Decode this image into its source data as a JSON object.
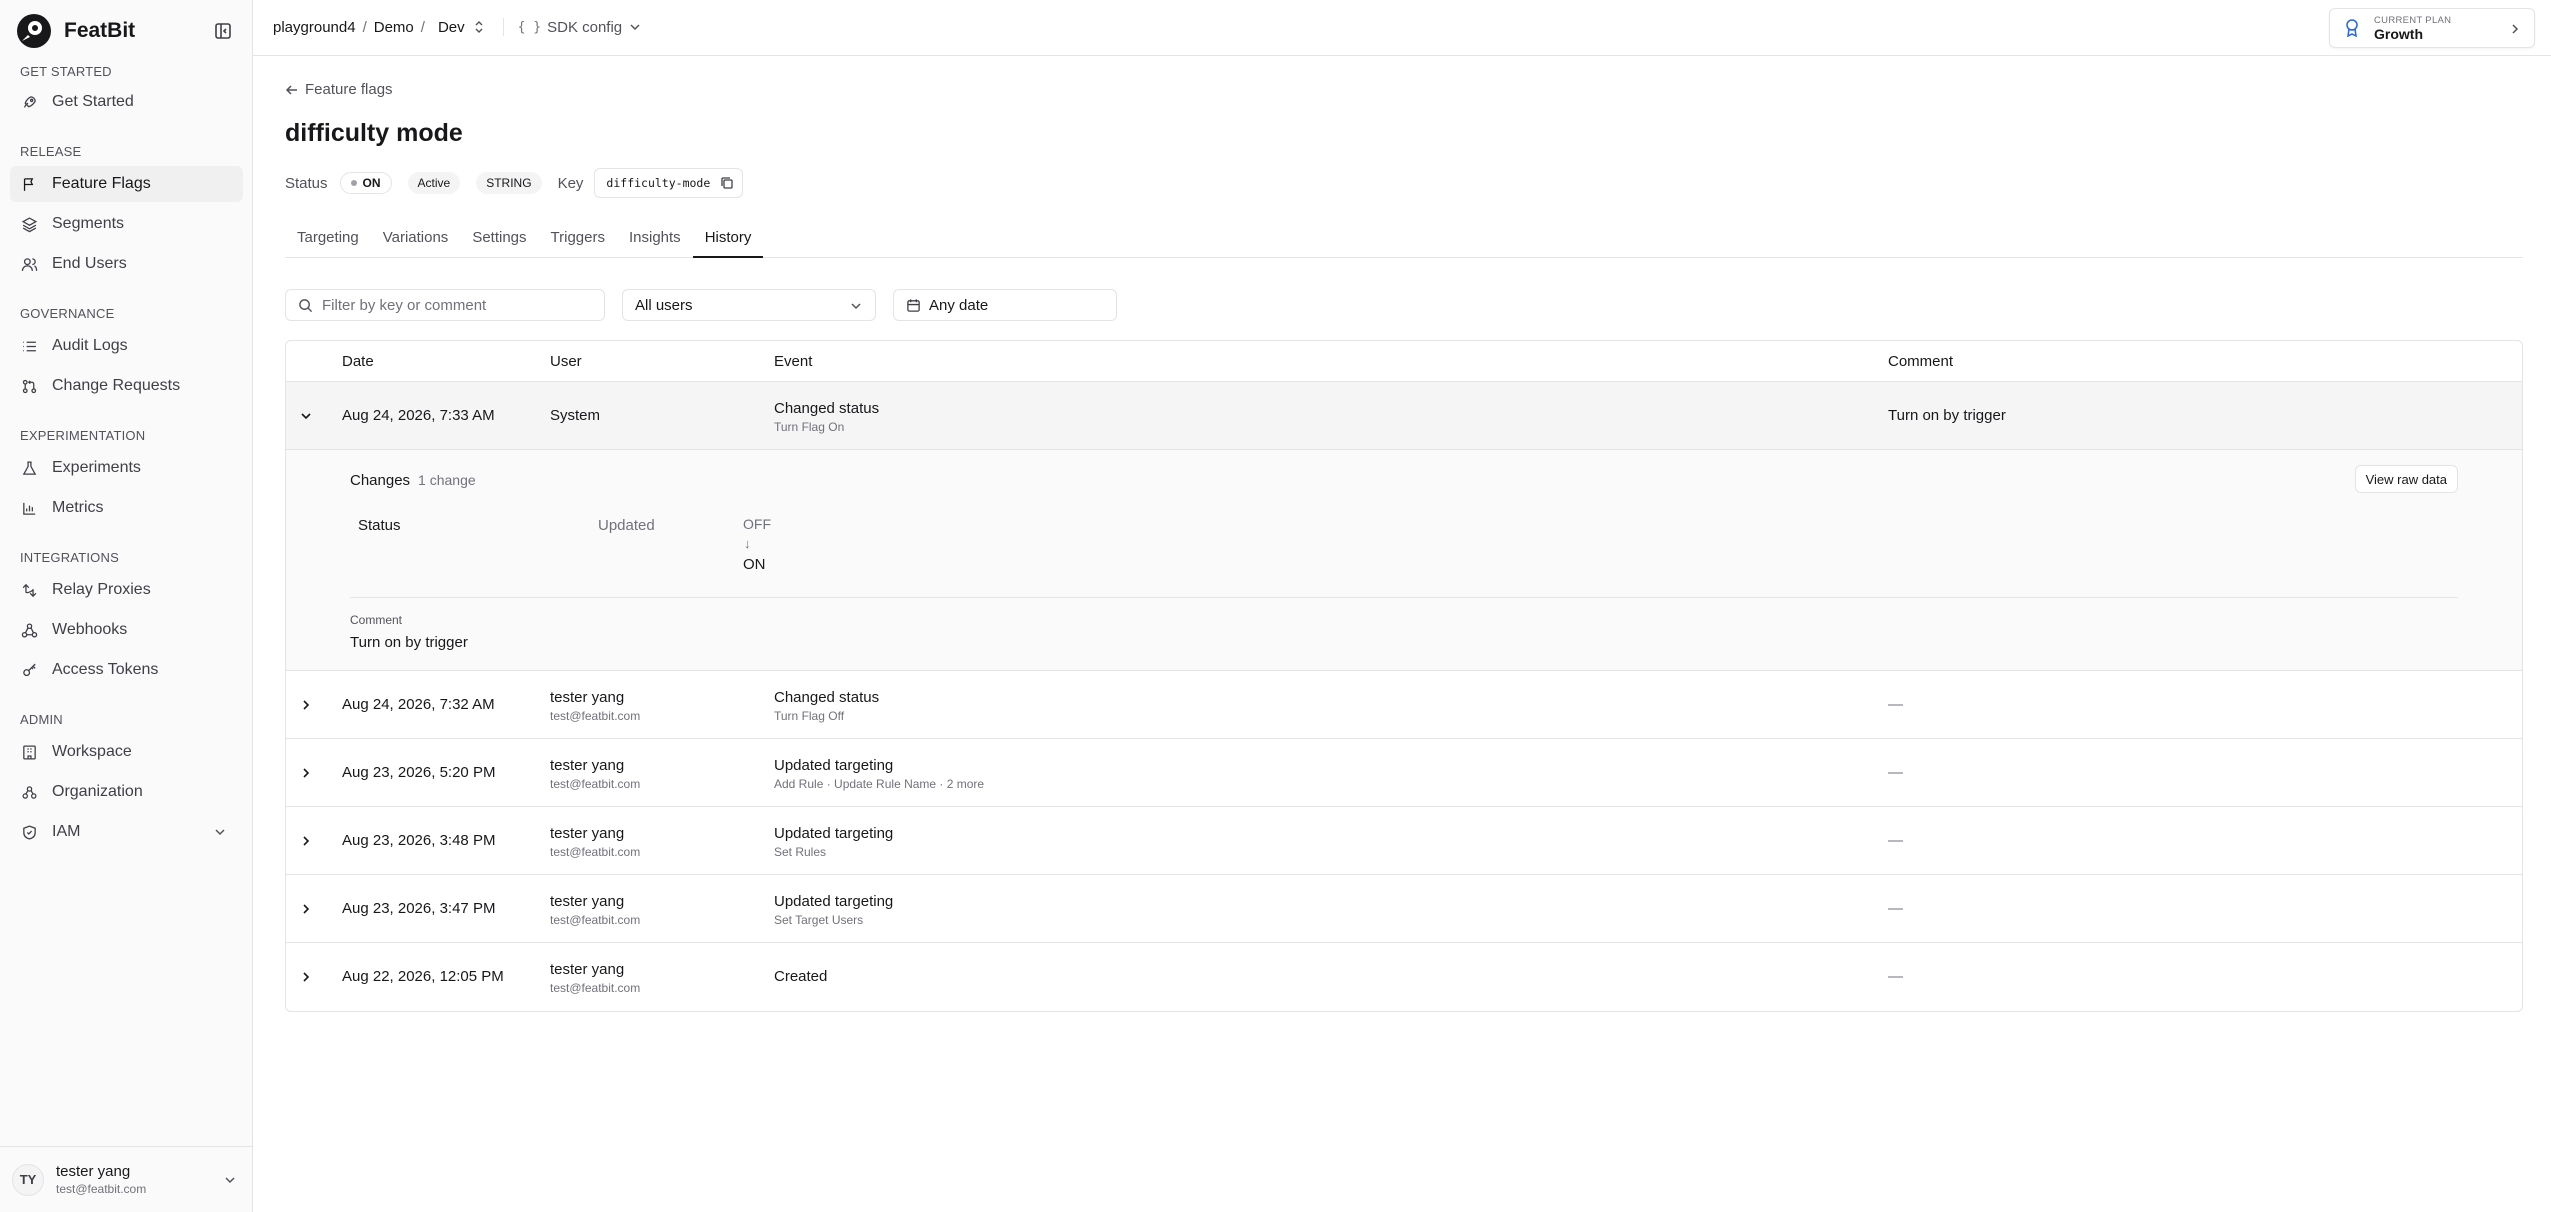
{
  "brand": {
    "name": "FeatBit"
  },
  "sidebar": {
    "groups": [
      {
        "title": "GET STARTED",
        "items": [
          {
            "label": "Get Started",
            "icon": "rocket-icon"
          }
        ]
      },
      {
        "title": "RELEASE",
        "items": [
          {
            "label": "Feature Flags",
            "icon": "flag-icon",
            "active": true
          },
          {
            "label": "Segments",
            "icon": "layers-icon"
          },
          {
            "label": "End Users",
            "icon": "users-icon"
          }
        ]
      },
      {
        "title": "GOVERNANCE",
        "items": [
          {
            "label": "Audit Logs",
            "icon": "list-icon"
          },
          {
            "label": "Change Requests",
            "icon": "git-pull-request-icon"
          }
        ]
      },
      {
        "title": "EXPERIMENTATION",
        "items": [
          {
            "label": "Experiments",
            "icon": "flask-icon"
          },
          {
            "label": "Metrics",
            "icon": "bar-chart-icon"
          }
        ]
      },
      {
        "title": "INTEGRATIONS",
        "items": [
          {
            "label": "Relay Proxies",
            "icon": "relay-icon"
          },
          {
            "label": "Webhooks",
            "icon": "webhook-icon"
          },
          {
            "label": "Access Tokens",
            "icon": "key-icon"
          }
        ]
      },
      {
        "title": "ADMIN",
        "items": [
          {
            "label": "Workspace",
            "icon": "building-icon"
          },
          {
            "label": "Organization",
            "icon": "org-icon"
          },
          {
            "label": "IAM",
            "icon": "shield-icon"
          }
        ]
      }
    ],
    "user": {
      "initials": "TY",
      "name": "tester yang",
      "email": "test@featbit.com"
    }
  },
  "topbar": {
    "breadcrumb": [
      "playground4",
      "Demo",
      "Dev"
    ],
    "separator": "/",
    "sdk_label": "SDK config",
    "sdk_braces": "{ }",
    "plan_label": "CURRENT PLAN",
    "plan_value": "Growth"
  },
  "page": {
    "back_label": "Feature flags",
    "title": "difficulty mode",
    "status_label": "Status",
    "status_value": "ON",
    "lifecycle": "Active",
    "type": "STRING",
    "key_label": "Key",
    "key_value": "difficulty-mode",
    "tabs": [
      "Targeting",
      "Variations",
      "Settings",
      "Triggers",
      "Insights",
      "History"
    ],
    "active_tab": "History"
  },
  "filters": {
    "search_placeholder": "Filter by key or comment",
    "user_select": "All users",
    "date_select": "Any date"
  },
  "table": {
    "headers": {
      "date": "Date",
      "user": "User",
      "event": "Event",
      "comment": "Comment"
    },
    "expanded": {
      "date": "Aug 24, 2026, 7:33 AM",
      "user": "System",
      "event_title": "Changed status",
      "event_sub": "Turn Flag On",
      "comment": "Turn on by trigger",
      "detail": {
        "changes_label": "Changes",
        "changes_count": "1 change",
        "raw_button": "View raw data",
        "field": "Status",
        "op": "Updated",
        "from": "OFF",
        "arrow": "↓",
        "to": "ON",
        "comment_label": "Comment",
        "comment_value": "Turn on by trigger"
      }
    },
    "rows": [
      {
        "date": "Aug 24, 2026, 7:32 AM",
        "user": "tester yang",
        "email": "test@featbit.com",
        "event_title": "Changed status",
        "event_sub": "Turn Flag Off",
        "comment": "—"
      },
      {
        "date": "Aug 23, 2026, 5:20 PM",
        "user": "tester yang",
        "email": "test@featbit.com",
        "event_title": "Updated targeting",
        "event_sub": "Add Rule · Update Rule Name · 2 more",
        "comment": "—"
      },
      {
        "date": "Aug 23, 2026, 3:48 PM",
        "user": "tester yang",
        "email": "test@featbit.com",
        "event_title": "Updated targeting",
        "event_sub": "Set Rules",
        "comment": "—"
      },
      {
        "date": "Aug 23, 2026, 3:47 PM",
        "user": "tester yang",
        "email": "test@featbit.com",
        "event_title": "Updated targeting",
        "event_sub": "Set Target Users",
        "comment": "—"
      },
      {
        "date": "Aug 22, 2026, 12:05 PM",
        "user": "tester yang",
        "email": "test@featbit.com",
        "event_title": "Created",
        "event_sub": "",
        "comment": "—"
      }
    ]
  }
}
